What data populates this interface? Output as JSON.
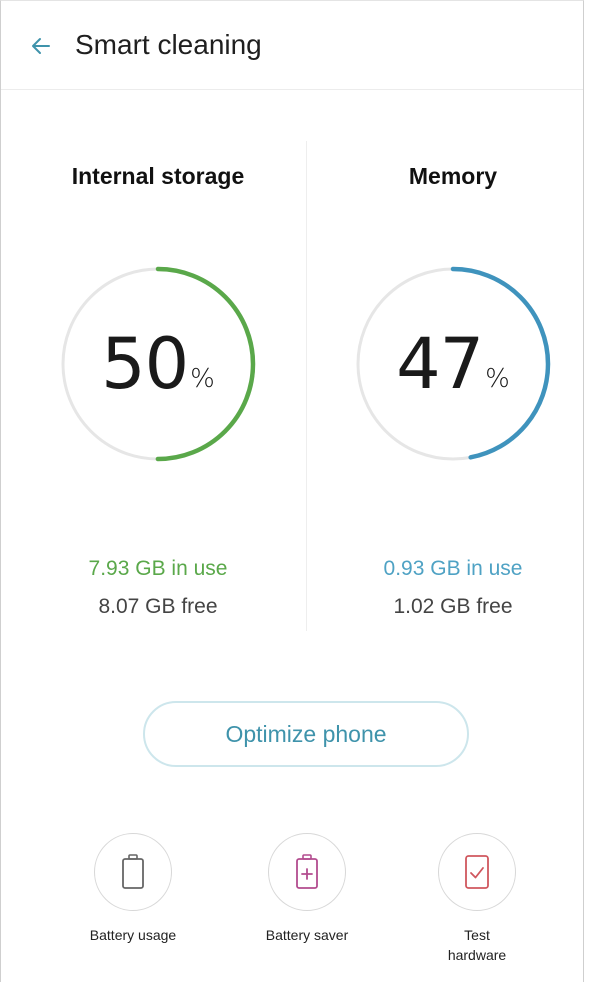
{
  "header": {
    "title": "Smart cleaning",
    "back_icon": "arrow-left-icon",
    "accent": "#3f93ab"
  },
  "storage": {
    "title": "Internal storage",
    "percent_number": "50",
    "percent_sign": "%",
    "percent": 50,
    "in_use": "7.93 GB in use",
    "free": "8.07 GB free",
    "color": "#5aa84a"
  },
  "memory": {
    "title": "Memory",
    "percent_number": "47",
    "percent_sign": "%",
    "percent": 47,
    "in_use": "0.93 GB in use",
    "free": "1.02 GB free",
    "color": "#3f93bd"
  },
  "optimize": {
    "label": "Optimize phone"
  },
  "tools": [
    {
      "label": "Battery usage",
      "icon": "battery-icon"
    },
    {
      "label": "Battery saver",
      "icon": "battery-saver-icon"
    },
    {
      "label": "Test\nhardware",
      "icon": "test-hardware-icon"
    }
  ]
}
